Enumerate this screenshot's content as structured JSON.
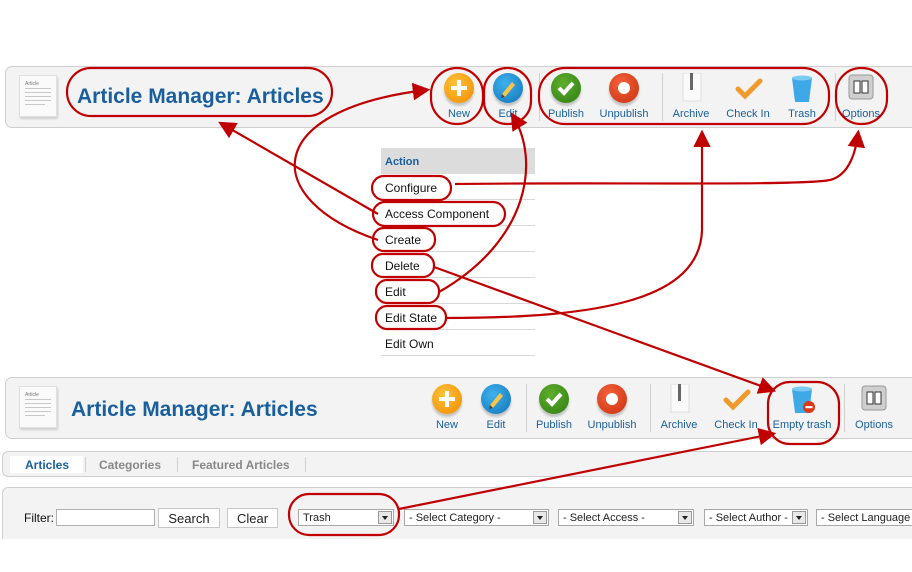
{
  "top_toolbar": {
    "title": "Article Manager: Articles",
    "article_icon_label": "Article",
    "buttons": [
      {
        "label": "New",
        "icon": "plus-circle-icon"
      },
      {
        "label": "Edit",
        "icon": "pencil-circle-icon"
      },
      {
        "label": "Publish",
        "icon": "check-circle-icon"
      },
      {
        "label": "Unpublish",
        "icon": "stop-circle-icon"
      },
      {
        "label": "Archive",
        "icon": "archive-zipper-icon"
      },
      {
        "label": "Check In",
        "icon": "checkmark-icon"
      },
      {
        "label": "Trash",
        "icon": "trash-bin-icon"
      },
      {
        "label": "Options",
        "icon": "options-switch-icon"
      }
    ]
  },
  "action_table": {
    "header": "Action",
    "rows": [
      "Configure",
      "Access Component",
      "Create",
      "Delete",
      "Edit",
      "Edit State",
      "Edit Own"
    ]
  },
  "bottom_toolbar": {
    "title": "Article Manager: Articles",
    "article_icon_label": "Article",
    "buttons": [
      {
        "label": "New",
        "icon": "plus-circle-icon"
      },
      {
        "label": "Edit",
        "icon": "pencil-circle-icon"
      },
      {
        "label": "Publish",
        "icon": "check-circle-icon"
      },
      {
        "label": "Unpublish",
        "icon": "stop-circle-icon"
      },
      {
        "label": "Archive",
        "icon": "archive-zipper-icon"
      },
      {
        "label": "Check In",
        "icon": "checkmark-icon"
      },
      {
        "label": "Empty trash",
        "icon": "empty-trash-icon"
      },
      {
        "label": "Options",
        "icon": "options-switch-icon"
      }
    ]
  },
  "tabs": [
    {
      "label": "Articles",
      "active": true
    },
    {
      "label": "Categories",
      "active": false
    },
    {
      "label": "Featured Articles",
      "active": false
    }
  ],
  "filter": {
    "label": "Filter:",
    "value": "",
    "search_label": "Search",
    "clear_label": "Clear",
    "selects": [
      {
        "value": "Trash"
      },
      {
        "value": "- Select Category -"
      },
      {
        "value": "- Select Access -"
      },
      {
        "value": "- Select Author -"
      },
      {
        "value": "- Select Language -"
      }
    ]
  },
  "colors": {
    "accent_blue": "#1a5f9c",
    "annotation_red": "#c00000",
    "toolbar_bg": "#f3f3f3"
  }
}
